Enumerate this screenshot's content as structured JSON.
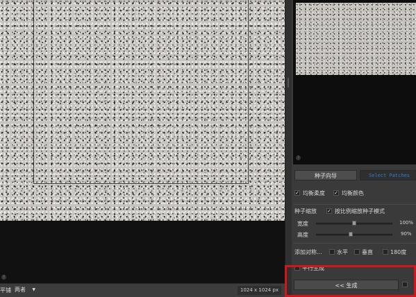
{
  "status_bar": {
    "tiling_label": "平铺",
    "mode_value": "两者",
    "size_readout": "1024 x 1024 px"
  },
  "right_panel": {
    "seed_guide_button": "种子向导",
    "select_button": "Select Patches",
    "balance_smoothness": {
      "label": "均衡柔度",
      "checked": true
    },
    "balance_color": {
      "label": "均衡颜色",
      "checked": true
    },
    "seed_scale_label": "种子缩放",
    "proportional_seed_mode": {
      "label": "按比例缩放种子模式",
      "checked": true
    },
    "width_slider": {
      "label": "宽度",
      "value_text": "100%",
      "value": 100
    },
    "height_slider": {
      "label": "高度",
      "value_text": "90%",
      "value": 90
    },
    "add_symmetry_label": "添加对称...",
    "horizontal": {
      "label": "水平",
      "checked": false
    },
    "vertical": {
      "label": "垂直",
      "checked": false
    },
    "rotate_180": {
      "label": "180度",
      "checked": false
    },
    "parallel_generate": {
      "label": "平行生成",
      "checked": false
    },
    "generate_button": "<< 生成"
  },
  "colors": {
    "highlight": "#d4161b",
    "select_text": "#2a7fd4"
  }
}
